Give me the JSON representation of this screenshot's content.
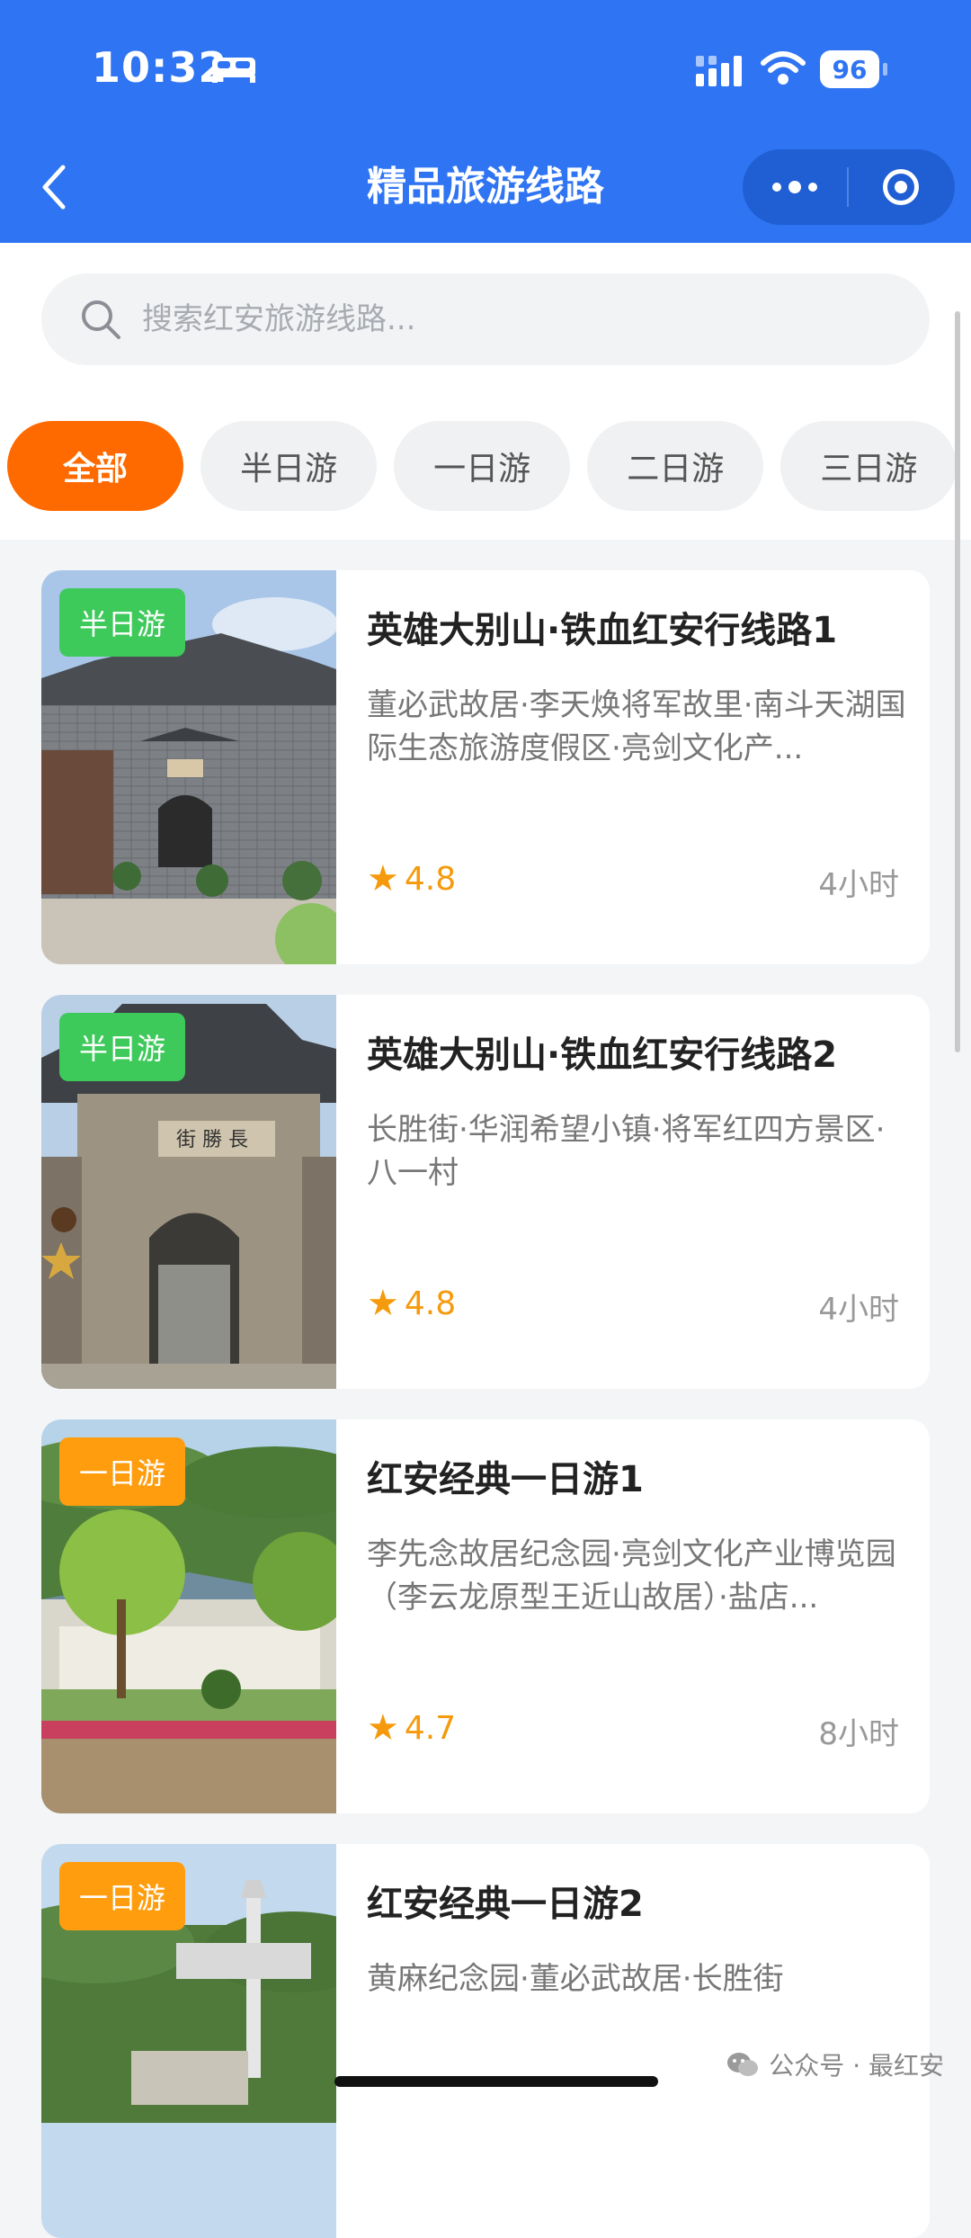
{
  "status_bar": {
    "time": "10:32",
    "battery": "96"
  },
  "nav": {
    "title": "精品旅游线路"
  },
  "search": {
    "placeholder": "搜索红安旅游线路..."
  },
  "tabs": [
    {
      "label": "全部",
      "active": true
    },
    {
      "label": "半日游",
      "active": false
    },
    {
      "label": "一日游",
      "active": false
    },
    {
      "label": "二日游",
      "active": false
    },
    {
      "label": "三日游",
      "active": false
    }
  ],
  "routes": [
    {
      "badge": "半日游",
      "badge_color": "#3ec95b",
      "title": "英雄大别山·铁血红安行线路1",
      "desc": "董必武故居·李天焕将军故里·南斗天湖国际生态旅游度假区·亮剑文化产...",
      "rating": "4.8",
      "duration": "4小时"
    },
    {
      "badge": "半日游",
      "badge_color": "#3ec95b",
      "title": "英雄大别山·铁血红安行线路2",
      "desc": "长胜街·华润希望小镇·将军红四方景区·八一村",
      "rating": "4.8",
      "duration": "4小时"
    },
    {
      "badge": "一日游",
      "badge_color": "#ff9d0e",
      "title": "红安经典一日游1",
      "desc": "李先念故居纪念园·亮剑文化产业博览园（李云龙原型王近山故居）·盐店...",
      "rating": "4.7",
      "duration": "8小时"
    },
    {
      "badge": "一日游",
      "badge_color": "#ff9d0e",
      "title": "红安经典一日游2",
      "desc": "黄麻纪念园·董必武故居·长胜街",
      "rating": "",
      "duration": ""
    }
  ],
  "watermark": {
    "text": "公众号 · 最红安"
  },
  "colors": {
    "primary": "#2f74f2",
    "accent": "#ff6a00",
    "star": "#f59a0c"
  },
  "icons": [
    "bed-icon",
    "signal-icon",
    "wifi-icon",
    "back-icon",
    "more-dots-icon",
    "close-target-icon",
    "search-icon",
    "star-icon",
    "wechat-icon"
  ]
}
